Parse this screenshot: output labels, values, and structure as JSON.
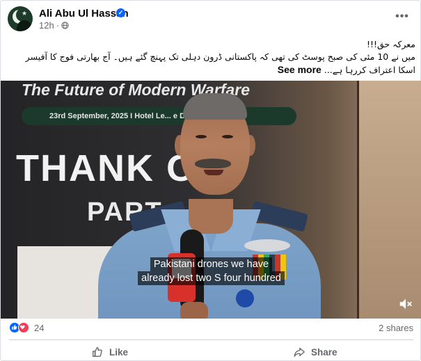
{
  "post": {
    "author": "Ali Abu Ul Hassan",
    "time": "12h",
    "text_lines": [
      "معرکہ حق!!!",
      "میں نے 10 مئی کی صبح پوسٹ کی تھی کہ پاکستانی ڈرون دہلی تک پہنچ گئے ہیں۔ آج بھارتی فوج کا آفیسر",
      "اسکا اعتراف کررہا ہے..."
    ],
    "see_more": "See more"
  },
  "video": {
    "banner_title": "The Future of Modern Warfare",
    "banner_date": "23rd September, 2025 I Hotel Le... e Delhi",
    "backdrop_big_text": "THANK OU",
    "backdrop_second_text": "PART",
    "caption_lines": [
      "Pakistani drones we have",
      "already lost two S four hundred"
    ]
  },
  "engagement": {
    "reaction_count": "24",
    "shares": "2 shares"
  },
  "actions": {
    "like_label": "Like",
    "share_label": "Share"
  },
  "icons": {
    "verified": "verified-badge-icon",
    "globe": "globe-icon",
    "more": "more-options-icon",
    "mute": "mute-icon",
    "like": "like-icon",
    "share": "share-icon"
  },
  "colors": {
    "brand_blue": "#0866ff",
    "love_red": "#f33e58",
    "secondary_text": "#65676b"
  }
}
